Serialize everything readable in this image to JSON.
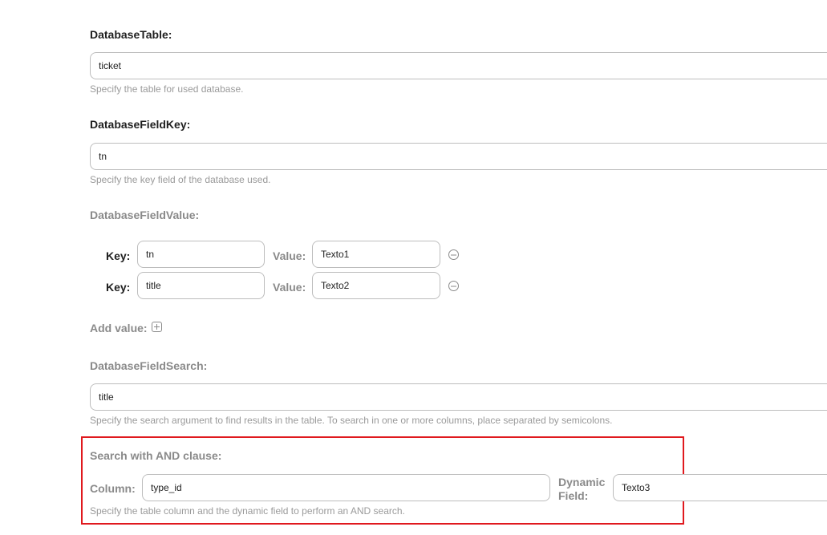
{
  "database_table": {
    "label": "DatabaseTable:",
    "value": "ticket",
    "help": "Specify the table for used database."
  },
  "database_field_key": {
    "label": "DatabaseFieldKey:",
    "value": "tn",
    "help": "Specify the key field of the database used."
  },
  "database_field_value": {
    "label": "DatabaseFieldValue:",
    "key_label": "Key:",
    "value_label": "Value:",
    "rows": [
      {
        "key": "tn",
        "value": "Texto1"
      },
      {
        "key": "title",
        "value": "Texto2"
      }
    ],
    "add_label": "Add value:"
  },
  "database_field_search": {
    "label": "DatabaseFieldSearch:",
    "value": "title",
    "help": "Specify the search argument to find results in the table. To search in one or more columns, place separated by semicolons."
  },
  "and_clause": {
    "label": "Search with AND clause:",
    "column_label": "Column:",
    "column_value": "type_id",
    "dynamic_label_line1": "Dynamic",
    "dynamic_label_line2": "Field:",
    "dynamic_value": "Texto3",
    "help": "Specify the table column and the dynamic field to perform an AND search.",
    "highlight_color": "#e0191e"
  },
  "icons": {
    "remove": "minus-circle-icon",
    "add": "plus-square-icon"
  }
}
